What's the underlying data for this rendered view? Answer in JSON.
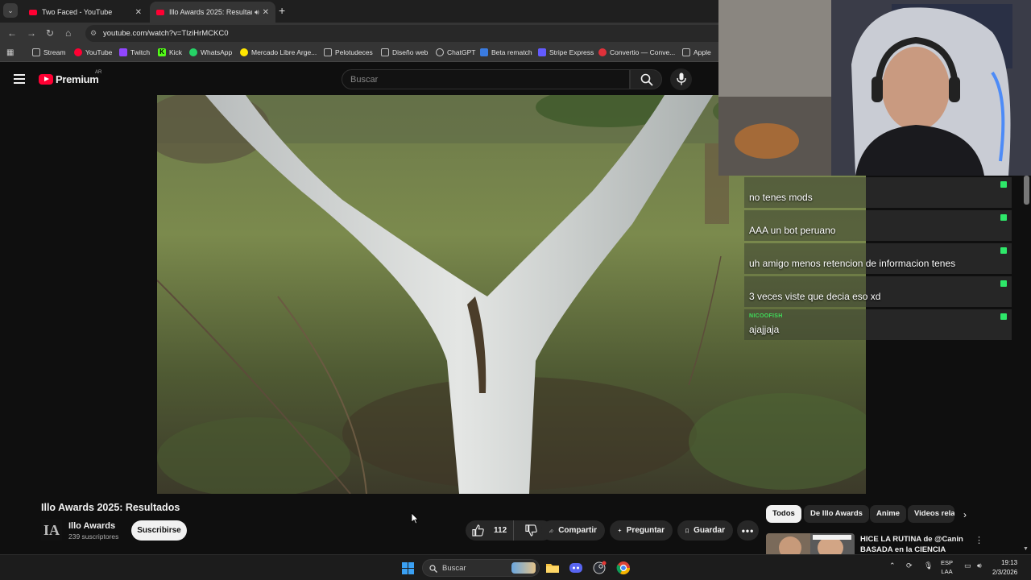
{
  "browser": {
    "tabs": [
      {
        "title": "Two Faced - YouTube"
      },
      {
        "title": "Illo Awards 2025: Resultados"
      }
    ],
    "address": "youtube.com/watch?v=TlziHrMCKC0",
    "bookmarks": [
      "Stream",
      "YouTube",
      "Twitch",
      "Kick",
      "WhatsApp",
      "Mercado Libre Arge...",
      "Pelotudeces",
      "Diseño web",
      "ChatGPT",
      "Beta rematch",
      "Stripe Express",
      "Convertio — Conve...",
      "Apple"
    ]
  },
  "youtube": {
    "logo_text": "Premium",
    "country": "AR",
    "search_placeholder": "Buscar"
  },
  "chat": [
    {
      "user": "",
      "message": "no tenes mods",
      "color": "#d23a4c"
    },
    {
      "user": "",
      "message": "AAA un bot peruano",
      "color": "#3f6fd6"
    },
    {
      "user": "",
      "message": "uh amigo menos retencion de informacion tenes",
      "color": "#d23a4c"
    },
    {
      "user": "",
      "message": "3 veces viste que decia eso xd",
      "color": "#d23a4c"
    },
    {
      "user": "NICOOFISH",
      "message": "ajajjaja",
      "color": "#3fdc5a"
    }
  ],
  "video": {
    "title": "Illo Awards 2025: Resultados",
    "channel": "Illo Awards",
    "channel_avatar": "IA",
    "subscribers": "239 suscriptores",
    "subscribe_label": "Suscribirse",
    "likes": "112",
    "share_label": "Compartir",
    "ask_label": "Preguntar",
    "save_label": "Guardar"
  },
  "chips": [
    "Todos",
    "De Illo Awards",
    "Anime",
    "Videos rela"
  ],
  "related": {
    "title": "HICE LA RUTINA de @Canin BASADA en la CIENCIA"
  },
  "taskbar": {
    "search_label": "Buscar",
    "lang_top": "ESP",
    "lang_bottom": "LAA",
    "time": "19:13",
    "date": "2/3/2026"
  }
}
